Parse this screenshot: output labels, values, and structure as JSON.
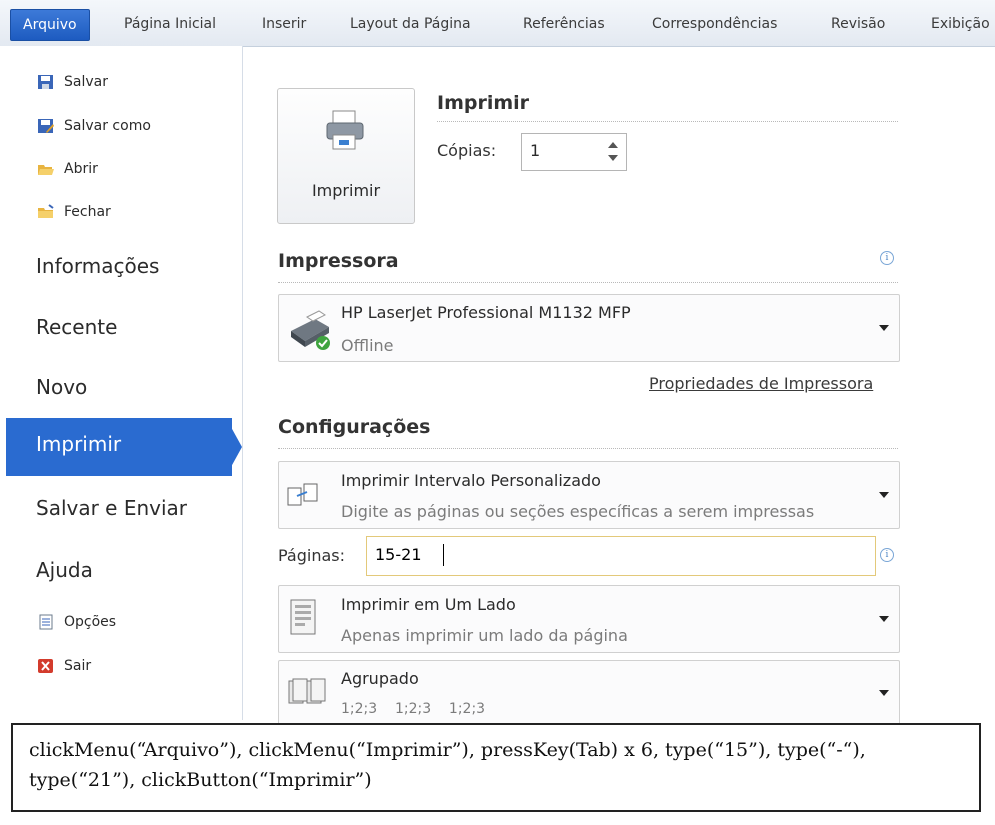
{
  "ribbon": {
    "tabs": [
      "Arquivo",
      "Página Inicial",
      "Inserir",
      "Layout da Página",
      "Referências",
      "Correspondências",
      "Revisão",
      "Exibição"
    ]
  },
  "sidebar": {
    "small_top": [
      {
        "label": "Salvar",
        "icon": "save-icon"
      },
      {
        "label": "Salvar como",
        "icon": "save-as-icon"
      },
      {
        "label": "Abrir",
        "icon": "open-folder-icon"
      },
      {
        "label": "Fechar",
        "icon": "close-folder-icon"
      }
    ],
    "big": [
      "Informações",
      "Recente",
      "Novo",
      "Imprimir",
      "Salvar e Enviar",
      "Ajuda"
    ],
    "small_bottom": [
      {
        "label": "Opções",
        "icon": "options-icon"
      },
      {
        "label": "Sair",
        "icon": "exit-icon"
      }
    ],
    "selected": "Imprimir"
  },
  "print": {
    "button_label": "Imprimir",
    "heading": "Imprimir",
    "copies_label": "Cópias:",
    "copies_value": "1"
  },
  "printer": {
    "heading": "Impressora",
    "name": "HP LaserJet Professional M1132 MFP",
    "status": "Offline",
    "properties_link": "Propriedades de Impressora"
  },
  "settings": {
    "heading": "Configurações",
    "range_title": "Imprimir Intervalo Personalizado",
    "range_sub": "Digite as páginas ou seções específicas a serem impressas",
    "pages_label": "Páginas:",
    "pages_value": "15-21",
    "sides_title": "Imprimir em Um Lado",
    "sides_sub": "Apenas imprimir um lado da página",
    "collate_title": "Agrupado",
    "collate_sub": "1;2;3    1;2;3    1;2;3"
  },
  "caption": {
    "text": "clickMenu(“Arquivo”), clickMenu(“Imprimir”), pressKey(Tab) x 6, type(“15”), type(“-“), type(“21”), clickButton(“Imprimir”)"
  },
  "colors": {
    "accent": "#2a6bd0",
    "tab_active": "#1d5bc0"
  }
}
